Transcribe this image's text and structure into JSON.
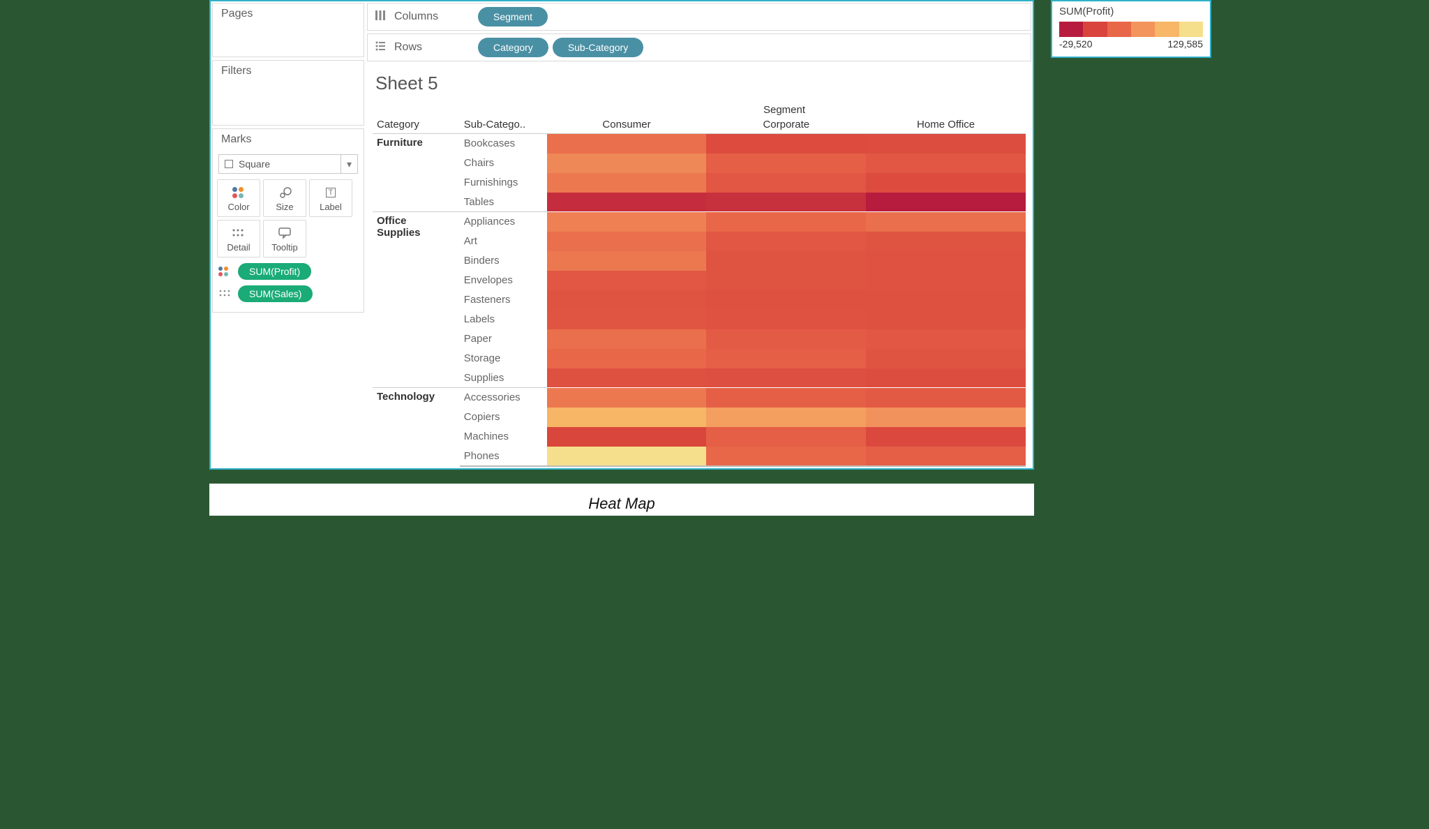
{
  "sidebar": {
    "pages_label": "Pages",
    "filters_label": "Filters",
    "marks_label": "Marks",
    "mark_type": "Square",
    "buttons": {
      "color": "Color",
      "size": "Size",
      "label": "Label",
      "detail": "Detail",
      "tooltip": "Tooltip"
    },
    "mark_pills": [
      {
        "glyph": "color",
        "label": "SUM(Profit)"
      },
      {
        "glyph": "detail",
        "label": "SUM(Sales)"
      }
    ]
  },
  "shelves": {
    "columns_label": "Columns",
    "columns_pills": [
      "Segment"
    ],
    "rows_label": "Rows",
    "rows_pills": [
      "Category",
      "Sub-Category"
    ]
  },
  "viz": {
    "title": "Sheet 5",
    "segment_header": "Segment",
    "row_headers": [
      "Category",
      "Sub-Catego.."
    ]
  },
  "legend": {
    "title": "SUM(Profit)",
    "min": "-29,520",
    "max": "129,585",
    "stops": [
      "#b71c3e",
      "#d9453c",
      "#e86749",
      "#f2945c",
      "#f7b766",
      "#f6df8c"
    ]
  },
  "caption": "Heat Map",
  "chart_data": {
    "type": "heatmap",
    "title": "Sheet 5",
    "xlabel": "Segment",
    "columns": [
      "Consumer",
      "Corporate",
      "Home Office"
    ],
    "row_dimensions": [
      "Category",
      "Sub-Category"
    ],
    "rows": [
      {
        "category": "Furniture",
        "sub": "Bookcases",
        "values": [
          20000,
          -2000,
          -1000
        ]
      },
      {
        "category": "Furniture",
        "sub": "Chairs",
        "values": [
          35000,
          10000,
          5000
        ]
      },
      {
        "category": "Furniture",
        "sub": "Furnishings",
        "values": [
          25000,
          5000,
          -2000
        ]
      },
      {
        "category": "Furniture",
        "sub": "Tables",
        "values": [
          -20000,
          -18000,
          -29520
        ]
      },
      {
        "category": "Office Supplies",
        "sub": "Appliances",
        "values": [
          30000,
          15000,
          20000
        ]
      },
      {
        "category": "Office Supplies",
        "sub": "Art",
        "values": [
          20000,
          5000,
          3000
        ]
      },
      {
        "category": "Office Supplies",
        "sub": "Binders",
        "values": [
          25000,
          3000,
          2000
        ]
      },
      {
        "category": "Office Supplies",
        "sub": "Envelopes",
        "values": [
          5000,
          3000,
          2000
        ]
      },
      {
        "category": "Office Supplies",
        "sub": "Fasteners",
        "values": [
          3000,
          1500,
          1000
        ]
      },
      {
        "category": "Office Supplies",
        "sub": "Labels",
        "values": [
          4000,
          2000,
          1500
        ]
      },
      {
        "category": "Office Supplies",
        "sub": "Paper",
        "values": [
          20000,
          8000,
          5000
        ]
      },
      {
        "category": "Office Supplies",
        "sub": "Storage",
        "values": [
          15000,
          10000,
          3000
        ]
      },
      {
        "category": "Office Supplies",
        "sub": "Supplies",
        "values": [
          1000,
          500,
          -500
        ]
      },
      {
        "category": "Technology",
        "sub": "Accessories",
        "values": [
          25000,
          10000,
          7000
        ]
      },
      {
        "category": "Technology",
        "sub": "Copiers",
        "values": [
          80000,
          55000,
          40000
        ]
      },
      {
        "category": "Technology",
        "sub": "Machines",
        "values": [
          -5000,
          10000,
          -3000
        ]
      },
      {
        "category": "Technology",
        "sub": "Phones",
        "values": [
          129585,
          15000,
          10000
        ]
      }
    ],
    "color_scale": {
      "min": -29520,
      "max": 129585
    }
  }
}
